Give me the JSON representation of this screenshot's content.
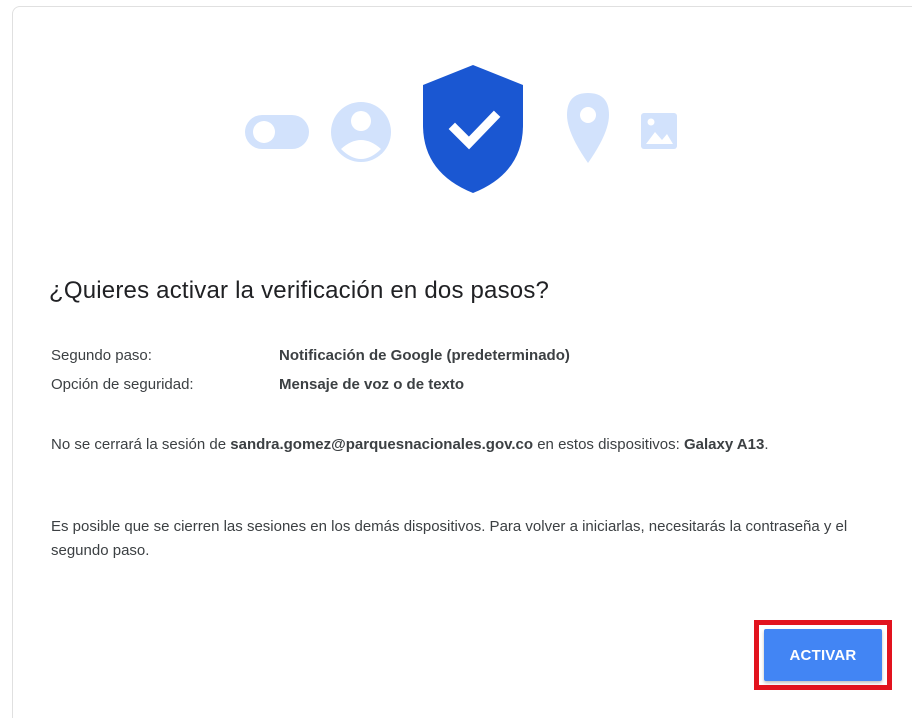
{
  "dialog": {
    "title": "¿Quieres activar la verificación en dos pasos?",
    "rows": [
      {
        "label": "Segundo paso:",
        "value": "Notificación de Google (predeterminado)"
      },
      {
        "label": "Opción de seguridad:",
        "value": "Mensaje de voz o de texto"
      }
    ],
    "session_text_before": "No se cerrará la sesión de ",
    "session_email": "sandra.gomez@parquesnacionales.gov.co",
    "session_text_after": " en estos dispositivos: ",
    "session_device": "Galaxy A13",
    "session_period": ".",
    "other_devices_text": "Es posible que se cierren las sesiones en los demás dispositivos. Para volver a iniciarlas, necesitarás la contraseña y el segundo paso.",
    "activate_label": "ACTIVAR"
  },
  "hero_icons": [
    "toggle-icon",
    "account-circle-icon",
    "shield-check-icon",
    "location-pin-icon",
    "image-icon"
  ],
  "colors": {
    "accent": "#4285f4",
    "shield": "#1a57d2",
    "icon_light": "#d2e2fc",
    "highlight": "#e2131e"
  }
}
